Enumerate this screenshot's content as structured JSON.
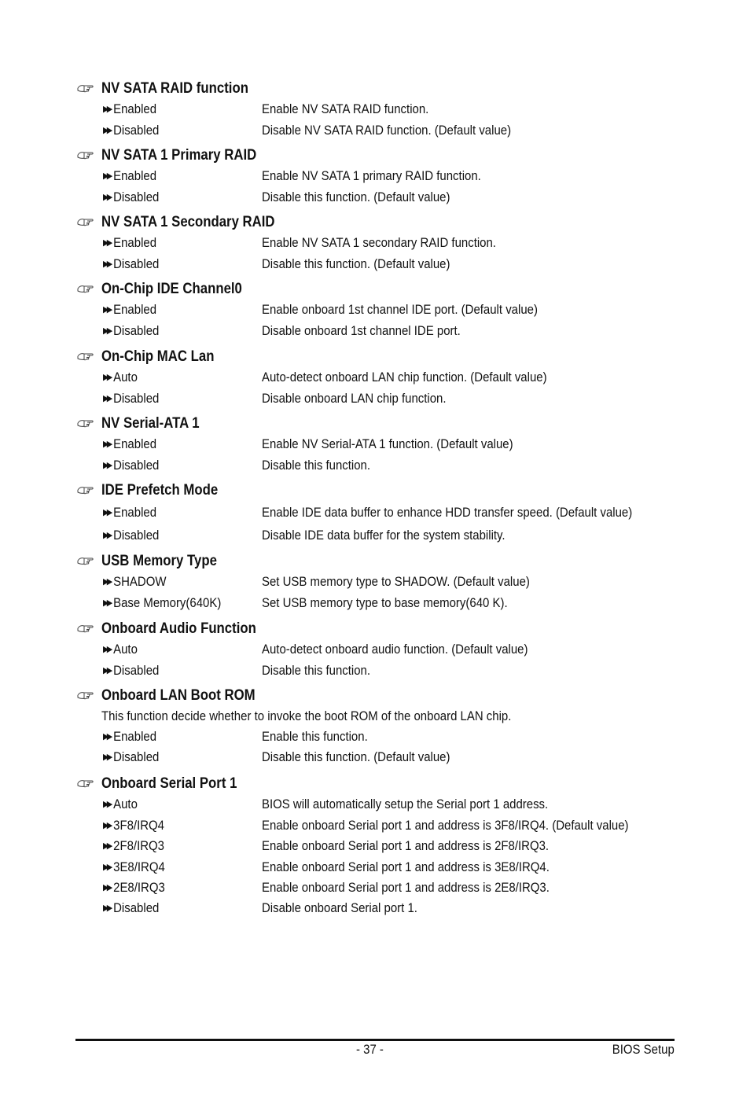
{
  "sections": [
    {
      "title": "NV SATA RAID function",
      "options": [
        {
          "label": "Enabled",
          "desc": "Enable NV SATA RAID function."
        },
        {
          "label": "Disabled",
          "desc": "Disable NV SATA RAID function. (Default value)"
        }
      ]
    },
    {
      "title": "NV SATA 1 Primary RAID",
      "options": [
        {
          "label": "Enabled",
          "desc": "Enable NV SATA 1 primary RAID function."
        },
        {
          "label": "Disabled",
          "desc": "Disable this function. (Default value)"
        }
      ]
    },
    {
      "title": "NV SATA 1 Secondary RAID",
      "options": [
        {
          "label": "Enabled",
          "desc": "Enable NV SATA 1 secondary RAID function."
        },
        {
          "label": "Disabled",
          "desc": "Disable this function. (Default value)"
        }
      ]
    },
    {
      "title": "On-Chip IDE Channel0",
      "options": [
        {
          "label": "Enabled",
          "desc": "Enable onboard 1st channel IDE port. (Default value)"
        },
        {
          "label": "Disabled",
          "desc": "Disable onboard 1st channel IDE port."
        }
      ]
    },
    {
      "title": "On-Chip MAC Lan",
      "options": [
        {
          "label": "Auto",
          "desc": "Auto-detect onboard LAN chip function. (Default value)"
        },
        {
          "label": "Disabled",
          "desc": "Disable onboard LAN chip function."
        }
      ]
    },
    {
      "title": "NV Serial-ATA 1",
      "options": [
        {
          "label": "Enabled",
          "desc": "Enable NV Serial-ATA 1 function. (Default value)"
        },
        {
          "label": "Disabled",
          "desc": "Disable this function."
        }
      ]
    },
    {
      "title": "IDE Prefetch Mode",
      "options": [
        {
          "label": "Enabled",
          "desc": "Enable IDE data buffer to enhance HDD transfer speed. (Default value)"
        },
        {
          "label": "Disabled",
          "desc": "Disable IDE data buffer for the system stability."
        }
      ]
    },
    {
      "title": "USB Memory Type",
      "options": [
        {
          "label": "SHADOW",
          "desc": "Set USB memory type to SHADOW. (Default value)"
        },
        {
          "label": "Base Memory(640K)",
          "desc": "Set USB memory type to base memory(640 K)."
        }
      ]
    },
    {
      "title": "Onboard Audio Function",
      "options": [
        {
          "label": "Auto",
          "desc": "Auto-detect onboard audio function. (Default value)"
        },
        {
          "label": "Disabled",
          "desc": "Disable this function."
        }
      ]
    },
    {
      "title": "Onboard  LAN Boot ROM",
      "note": "This function decide whether to invoke the boot ROM of the onboard LAN chip.",
      "options": [
        {
          "label": "Enabled",
          "desc": "Enable this function."
        },
        {
          "label": "Disabled",
          "desc": "Disable this function. (Default value)"
        }
      ]
    },
    {
      "title": "Onboard Serial Port 1",
      "options": [
        {
          "label": "Auto",
          "desc": "BIOS will automatically setup the Serial port 1 address."
        },
        {
          "label": "3F8/IRQ4",
          "desc": "Enable onboard Serial port 1 and address is 3F8/IRQ4. (Default value)"
        },
        {
          "label": "2F8/IRQ3",
          "desc": "Enable onboard Serial port 1 and address is 2F8/IRQ3."
        },
        {
          "label": "3E8/IRQ4",
          "desc": "Enable onboard Serial port 1 and address is 3E8/IRQ4."
        },
        {
          "label": "2E8/IRQ3",
          "desc": "Enable onboard Serial port 1 and address is 2E8/IRQ3."
        },
        {
          "label": "Disabled",
          "desc": "Disable onboard Serial port 1."
        }
      ]
    }
  ],
  "icons": {
    "heading": "pointing-hand-icon",
    "option": "double-arrow-icon"
  },
  "footer": {
    "page_number": "- 37 -",
    "title": "BIOS Setup"
  }
}
